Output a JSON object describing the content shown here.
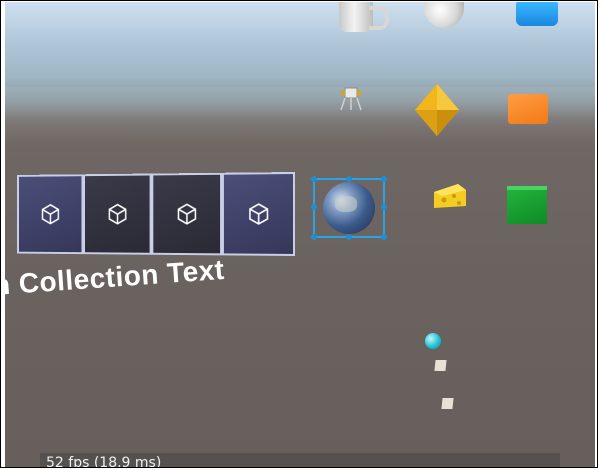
{
  "scene": {
    "collection_text": "n Collection Text",
    "fps_readout": "52 fps (18.9 ms)"
  },
  "panel": {
    "tiles": [
      {
        "icon": "cube-icon",
        "tone": "light"
      },
      {
        "icon": "cube-icon",
        "tone": "dark"
      },
      {
        "icon": "cube-icon",
        "tone": "dark"
      },
      {
        "icon": "cube-icon",
        "tone": "light"
      }
    ]
  },
  "objects": [
    "mug",
    "soccer-ball",
    "blue-box",
    "lunar-lander",
    "octahedron",
    "orange-box",
    "globe",
    "cheese",
    "green-cube",
    "cyan-sphere",
    "small-square",
    "small-square"
  ],
  "colors": {
    "bounding_box": "#2aa3e6",
    "octahedron": "#f2b51c",
    "green_cube": "#1a9f33",
    "orange_box": "#f58a25",
    "blue_box": "#2a9ff0"
  }
}
